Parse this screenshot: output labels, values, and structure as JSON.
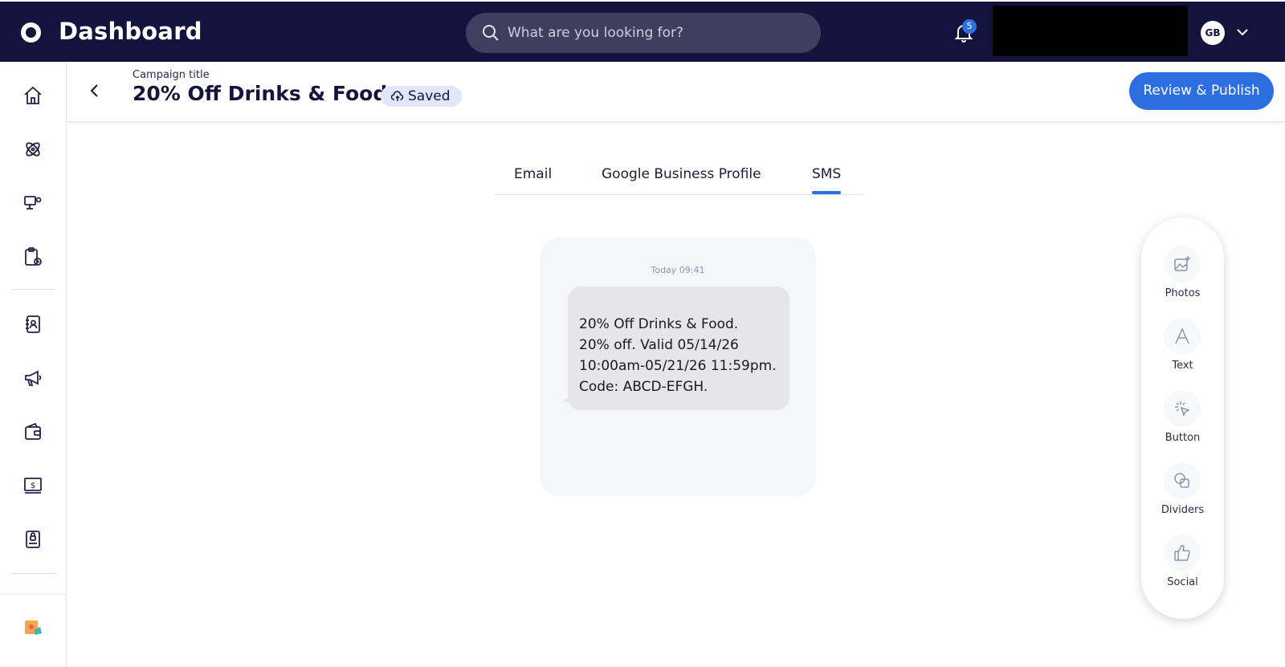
{
  "app": {
    "title": "Dashboard"
  },
  "search": {
    "placeholder": "What are you looking for?"
  },
  "notifications": {
    "count": "5"
  },
  "user": {
    "initials": "GB"
  },
  "campaign": {
    "label": "Campaign title",
    "title": "20% Off Drinks & Food",
    "status": "Saved",
    "publish_label": "Review & Publish"
  },
  "tabs": [
    {
      "label": "Email"
    },
    {
      "label": "Google Business Profile"
    },
    {
      "label": "SMS"
    }
  ],
  "active_tab": "SMS",
  "preview": {
    "timestamp": "Today 09:41",
    "message": "20% Off Drinks & Food.\n20% off. Valid 05/14/26\n10:00am-05/21/26 11:59pm.\nCode: ABCD-EFGH."
  },
  "tools": [
    {
      "label": "Photos",
      "icon": "image-add-icon"
    },
    {
      "label": "Text",
      "icon": "text-icon"
    },
    {
      "label": "Button",
      "icon": "cursor-click-icon"
    },
    {
      "label": "Dividers",
      "icon": "shapes-icon"
    },
    {
      "label": "Social",
      "icon": "thumbs-up-icon"
    }
  ],
  "sidebar": {
    "items": [
      {
        "icon": "home-icon"
      },
      {
        "icon": "atom-icon"
      },
      {
        "icon": "monitor-settings-icon"
      },
      {
        "icon": "clipboard-clock-icon"
      },
      {
        "icon": "contacts-book-icon"
      },
      {
        "icon": "megaphone-icon"
      },
      {
        "icon": "wallet-icon"
      },
      {
        "icon": "dollar-screen-icon"
      },
      {
        "icon": "document-lock-icon"
      },
      {
        "icon": "promo-badge-icon"
      }
    ]
  },
  "colors": {
    "topbar": "#14133d",
    "accent": "#2b6fe0",
    "saved_badge": "#e3e6fa"
  }
}
